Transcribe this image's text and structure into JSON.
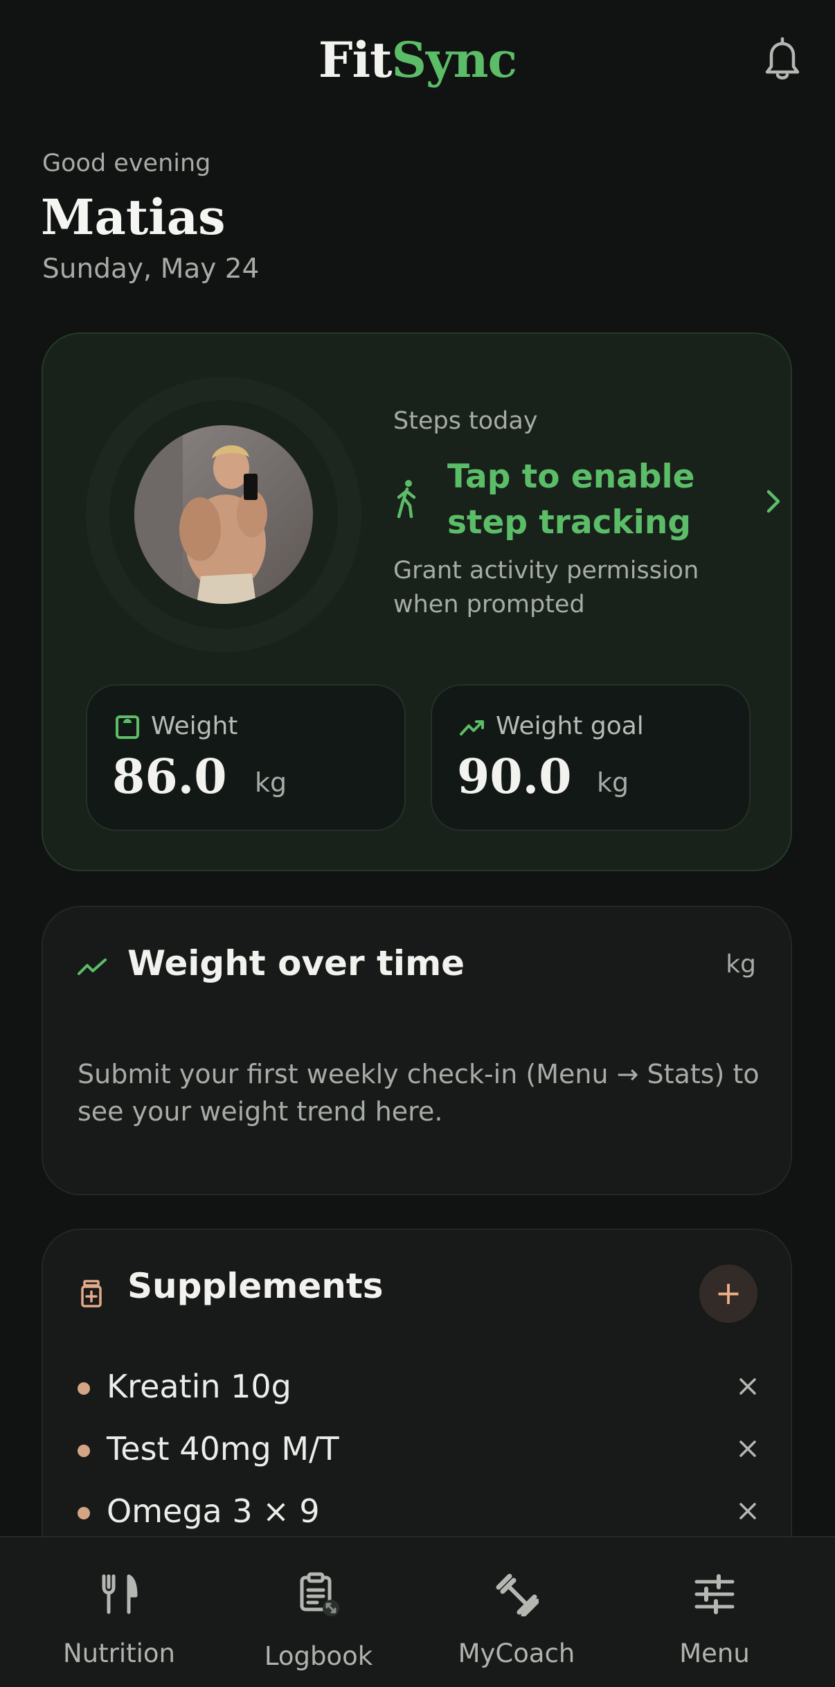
{
  "header": {
    "logo_part1": "Fit",
    "logo_part2": "Sync",
    "notifications_icon": "bell-icon"
  },
  "greeting": {
    "salutation": "Good evening",
    "name": "Matias",
    "date": "Sunday, May 24"
  },
  "hero": {
    "steps_label": "Steps today",
    "steps_cta": "Tap to enable step tracking",
    "steps_hint": "Grant activity permission when prompted",
    "weight": {
      "label": "Weight",
      "value": "86.0",
      "unit": "kg",
      "icon": "scale-icon"
    },
    "weight_goal": {
      "label": "Weight goal",
      "value": "90.0",
      "unit": "kg",
      "icon": "trending-up-icon"
    }
  },
  "weight_card": {
    "title": "Weight over time",
    "unit": "kg",
    "message": "Submit your first weekly check-in (Menu → Stats) to see your weight trend here."
  },
  "supplements": {
    "title": "Supplements",
    "add_label": "+",
    "items": [
      {
        "name": "Kreatin 10g"
      },
      {
        "name": "Test 40mg M/T"
      },
      {
        "name": "Omega 3 × 9"
      }
    ]
  },
  "nav": {
    "items": [
      {
        "label": "Nutrition",
        "icon": "fork-knife-icon"
      },
      {
        "label": "Logbook",
        "icon": "clipboard-icon"
      },
      {
        "label": "MyCoach",
        "icon": "dumbbell-icon"
      },
      {
        "label": "Menu",
        "icon": "sliders-icon"
      }
    ]
  },
  "colors": {
    "background": "#101311",
    "accent_green": "#5cbd68",
    "accent_peach": "#d4a584"
  }
}
